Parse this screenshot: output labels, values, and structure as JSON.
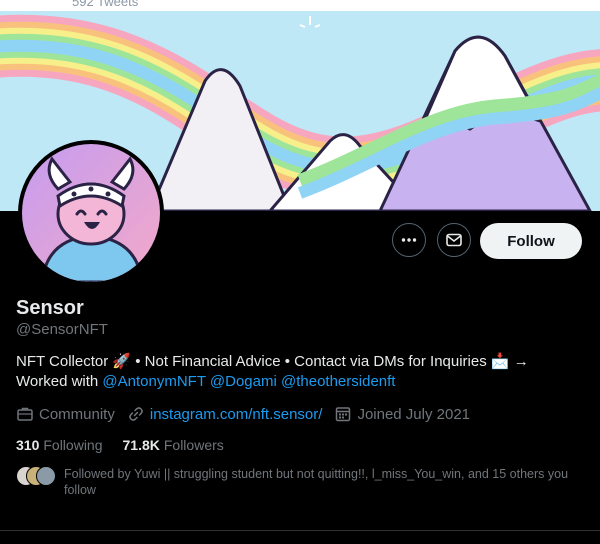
{
  "header": {
    "tweet_count": "592 Tweets"
  },
  "banner": {
    "description": "pastel rainbow and snowy mountains illustration"
  },
  "avatar": {
    "description": "cartoon viking character avatar"
  },
  "actions": {
    "more_icon": "more-horizontal-icon",
    "message_icon": "mail-icon",
    "follow_label": "Follow"
  },
  "profile": {
    "name": "Sensor",
    "handle": "@SensorNFT",
    "bio_line1": "NFT Collector 🚀 • Not Financial Advice • Contact via DMs for Inquiries 📩 →",
    "bio_line2_prefix": "Worked with ",
    "mentions": [
      "@AntonymNFT",
      "@Dogami",
      "@theothersidenft"
    ],
    "category": "Community",
    "website": "instagram.com/nft.sensor/",
    "joined": "Joined July 2021"
  },
  "stats": {
    "following_count": "310",
    "following_label": "Following",
    "followers_count": "71.8K",
    "followers_label": "Followers"
  },
  "followed_by": {
    "text": "Followed by Yuwi || struggling student but not quitting!!, l_miss_You_win, and 15 others you follow"
  },
  "colors": {
    "background": "#000000",
    "text_primary": "#e7e9ea",
    "text_secondary": "#71767b",
    "link": "#1d9bf0",
    "follow_button_bg": "#eff3f4"
  }
}
